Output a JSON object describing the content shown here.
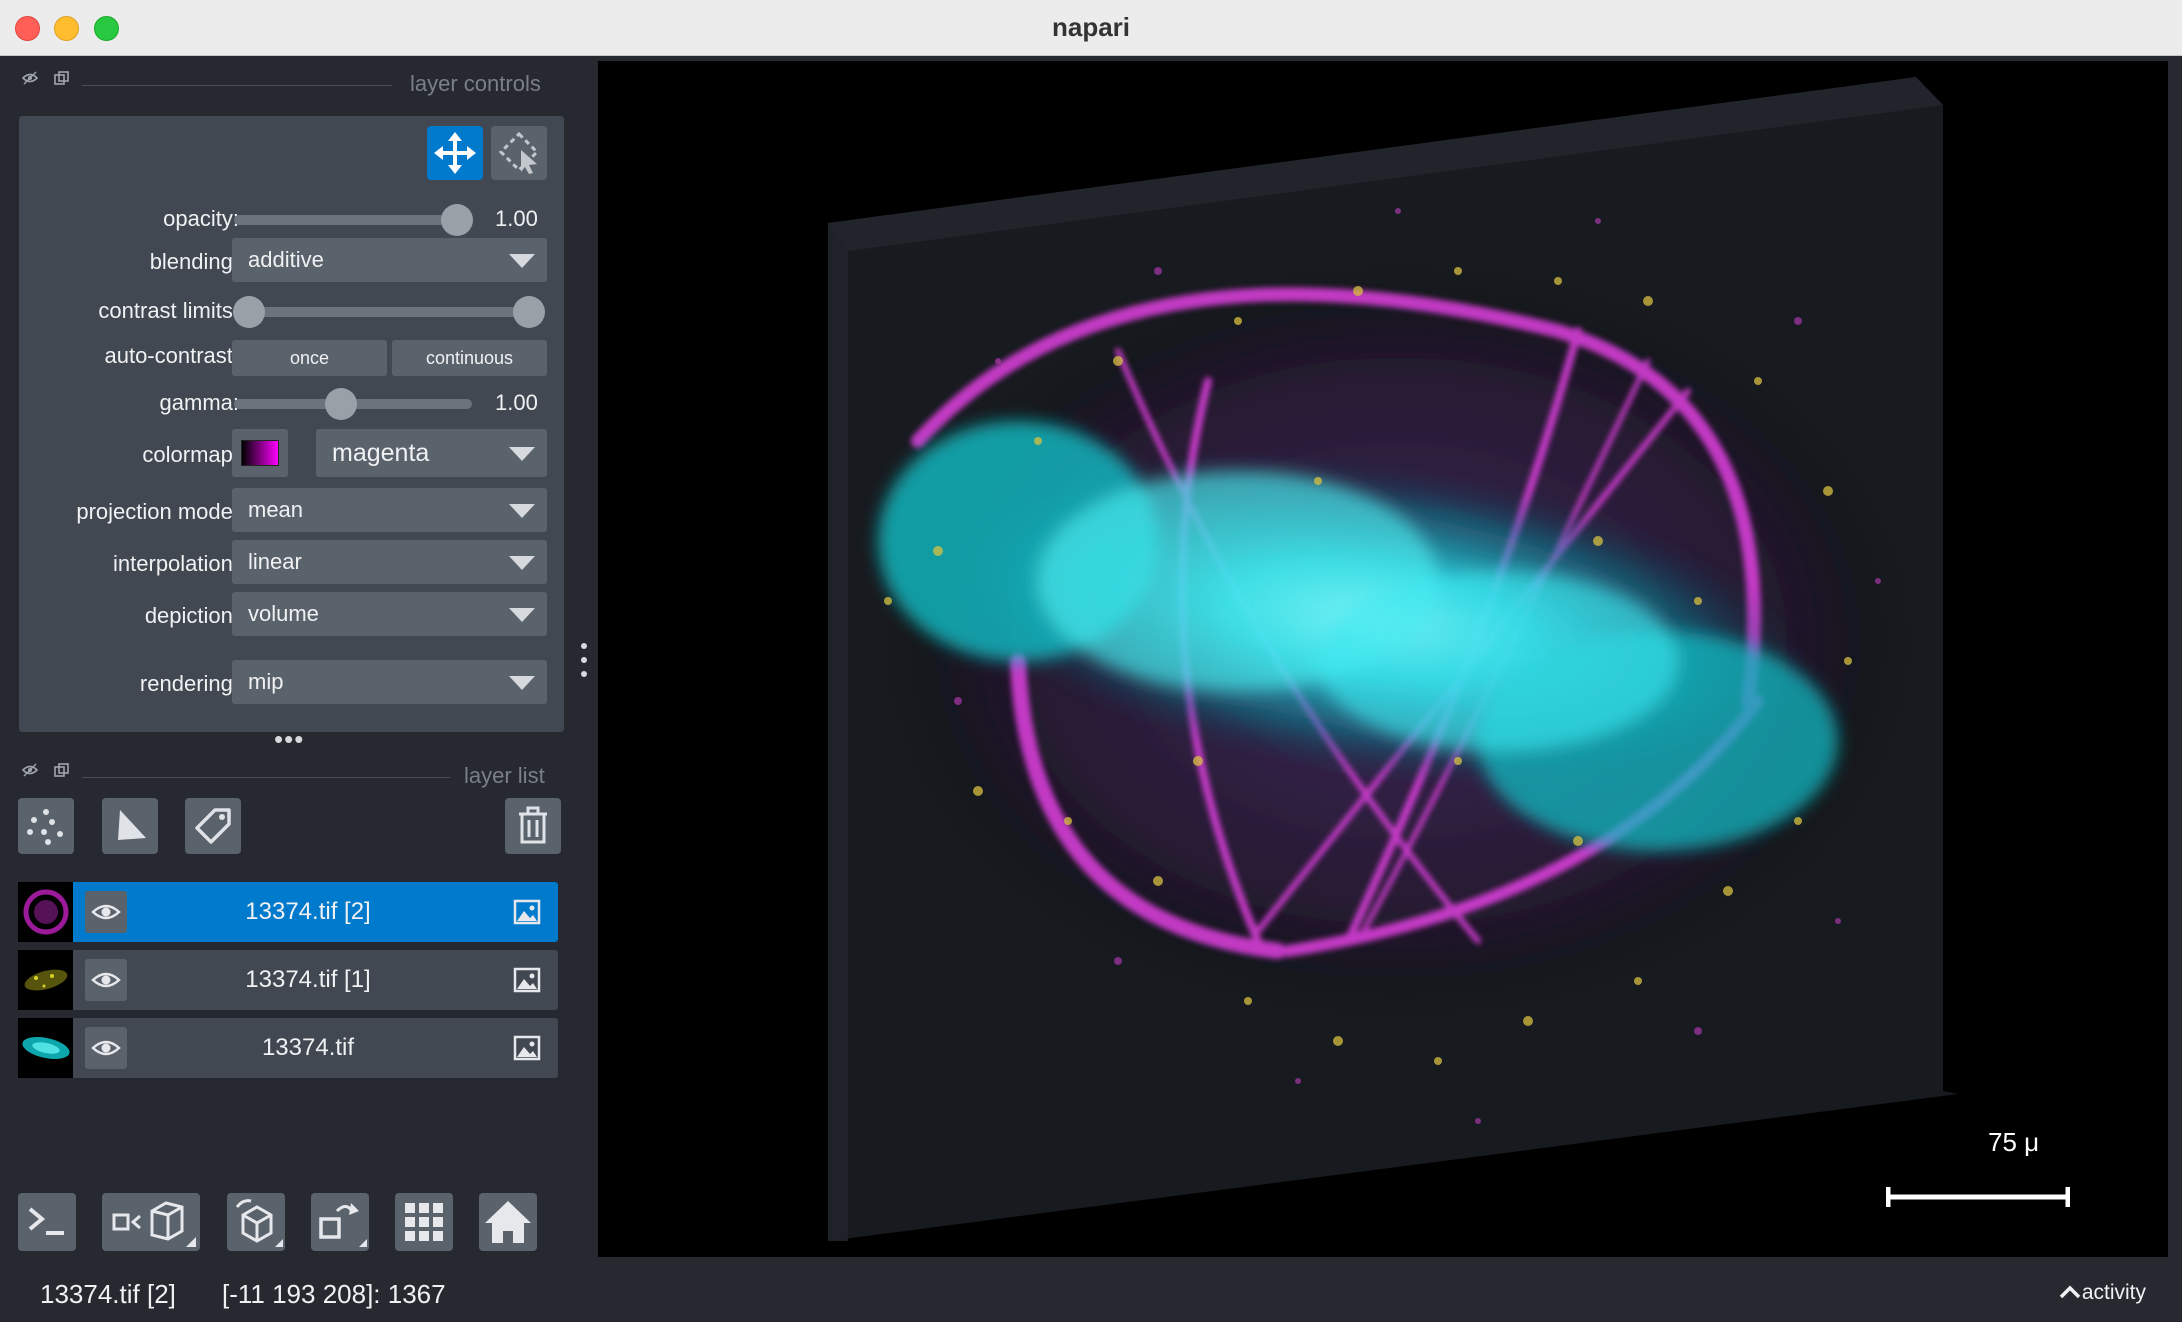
{
  "window": {
    "title": "napari"
  },
  "dock": {
    "layer_controls_title": "layer controls",
    "layer_list_title": "layer list"
  },
  "controls": {
    "opacity_label": "opacity:",
    "opacity_value": "1.00",
    "opacity_level": 1.0,
    "blending_label": "blending:",
    "blending_value": "additive",
    "contrast_label": "contrast limits:",
    "auto_contrast_label": "auto-contrast:",
    "once_label": "once",
    "continuous_label": "continuous",
    "gamma_label": "gamma:",
    "gamma_value": "1.00",
    "colormap_label": "colormap:",
    "colormap_value": "magenta",
    "projection_label": "projection mode:",
    "projection_value": "mean",
    "interpolation_label": "interpolation:",
    "interpolation_value": "linear",
    "depiction_label": "depiction:",
    "depiction_value": "volume",
    "rendering_label": "rendering:",
    "rendering_value": "mip",
    "active_color": "#007acc"
  },
  "layers": [
    {
      "name": "13374.tif [2]",
      "selected": true,
      "color": "#ff00ff"
    },
    {
      "name": "13374.tif [1]",
      "selected": false,
      "color": "#cccc00"
    },
    {
      "name": "13374.tif",
      "selected": false,
      "color": "#00d8e0"
    }
  ],
  "canvas": {
    "scale_bar_label": "75 μ"
  },
  "status": {
    "layer": "13374.tif [2]",
    "coords": "[-11 193 208]: 1367",
    "activity": "activity"
  }
}
